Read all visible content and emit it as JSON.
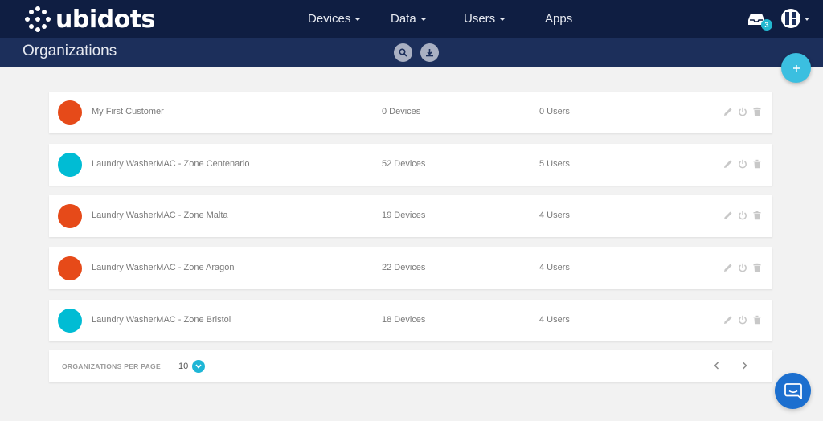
{
  "brand": {
    "name": "ubidots"
  },
  "nav": {
    "items": [
      {
        "label": "Devices",
        "dropdown": true
      },
      {
        "label": "Data",
        "dropdown": true
      },
      {
        "label": "Users",
        "dropdown": true
      },
      {
        "label": "Apps",
        "dropdown": false
      }
    ],
    "notifications_count": "3"
  },
  "page": {
    "title": "Organizations"
  },
  "organizations": [
    {
      "name": "My First Customer",
      "devices": "0 Devices",
      "users": "0 Users",
      "color": "#e64a19"
    },
    {
      "name": "Laundry WasherMAC - Zone Centenario",
      "devices": "52 Devices",
      "users": "5 Users",
      "color": "#00bcd4"
    },
    {
      "name": "Laundry WasherMAC - Zone Malta",
      "devices": "19 Devices",
      "users": "4 Users",
      "color": "#e64a19"
    },
    {
      "name": "Laundry WasherMAC - Zone Aragon",
      "devices": "22 Devices",
      "users": "4 Users",
      "color": "#e64a19"
    },
    {
      "name": "Laundry WasherMAC - Zone Bristol",
      "devices": "18 Devices",
      "users": "4 Users",
      "color": "#00bcd4"
    }
  ],
  "pagination": {
    "per_page_label": "ORGANIZATIONS PER PAGE",
    "per_page_value": "10"
  },
  "icons": {
    "search": "search-icon",
    "download": "download-icon",
    "add": "plus-icon",
    "edit": "pencil-icon",
    "power": "power-icon",
    "delete": "trash-icon",
    "prev": "chevron-left-icon",
    "next": "chevron-right-icon",
    "chat": "chat-icon"
  },
  "colors": {
    "topbar": "#0f1e42",
    "subbar": "#1c2f5b",
    "accent": "#23b8d0",
    "chat": "#1c6fcf"
  }
}
